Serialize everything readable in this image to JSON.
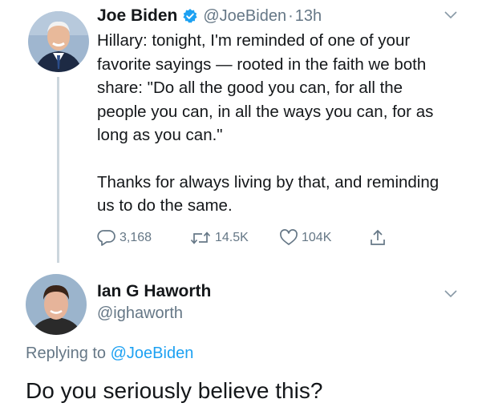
{
  "tweet": {
    "author_name": "Joe Biden",
    "handle": "@JoeBiden",
    "separator": "·",
    "time": "13h",
    "paragraph1": "Hillary: tonight, I'm reminded of one of your favorite sayings — rooted in the faith we both share: \"Do all the good you can, for all the people you can, in all the ways you can, for as long as you can.\"",
    "paragraph2": "Thanks for always living by that, and reminding us to do the same.",
    "replies": "3,168",
    "retweets": "14.5K",
    "likes": "104K",
    "icons": {
      "verified": "verified-badge-icon",
      "menu": "chevron-down-icon",
      "reply": "reply-icon",
      "retweet": "retweet-icon",
      "like": "heart-icon",
      "share": "share-icon"
    }
  },
  "reply": {
    "author_name": "Ian G Haworth",
    "handle": "@ighaworth",
    "replying_prefix": "Replying to ",
    "replying_to": "@JoeBiden",
    "text": "Do you seriously believe this?"
  },
  "colors": {
    "text": "#14171a",
    "secondary": "#657786",
    "accent": "#1da1f2",
    "thread_line": "#ccd6dd"
  }
}
